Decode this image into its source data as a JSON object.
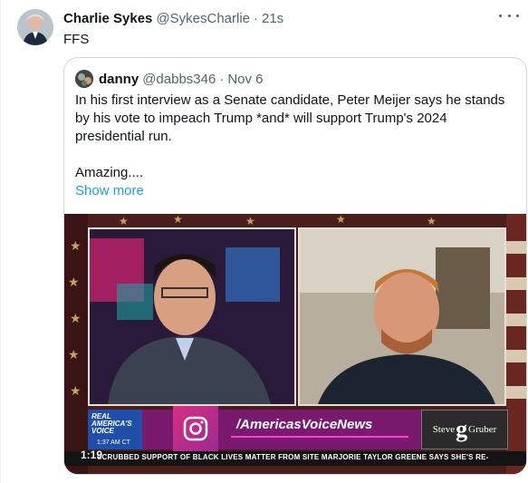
{
  "tweet": {
    "author_name": "Charlie Sykes",
    "author_handle": "@SykesCharlie",
    "separator": "·",
    "time": "21s",
    "text": "FFS"
  },
  "quoted_tweet": {
    "author_name": "danny",
    "author_handle": "@dabbs346",
    "separator": "·",
    "date": "Nov 6",
    "paragraph1": "In his first interview as a Senate candidate, Peter Meijer says he stands by his vote to impeach Trump *and* will support Trump's 2024 presidential run.",
    "paragraph2": "Amazing....",
    "show_more_label": "Show more"
  },
  "video": {
    "timestamp": "1:19",
    "banner_handle": "/AmericasVoiceNews",
    "logo_left": "Steve",
    "logo_g": "g",
    "logo_right": "Gruber",
    "network_label": "REAL AMERICA'S VOICE",
    "network_time": "1:37 AM CT",
    "ticker": "SCRUBBED SUPPORT OF BLACK LIVES MATTER FROM SITE     MARJORIE TAYLOR GREENE SAYS SHE'S RE-"
  },
  "colors": {
    "link": "#1d9bf0",
    "secondary_text": "#536471",
    "border": "#cfd9de"
  },
  "icons": [
    "more-options-icon",
    "instagram-icon"
  ]
}
